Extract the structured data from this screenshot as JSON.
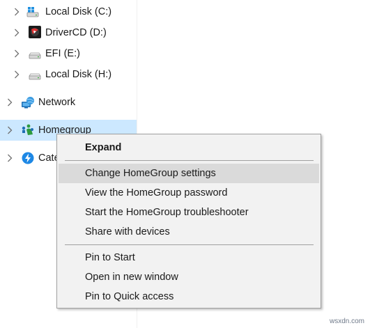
{
  "tree": {
    "items": [
      {
        "label": "Local Disk (C:)",
        "icon": "windows-drive-icon"
      },
      {
        "label": "DriverCD (D:)",
        "icon": "cd-drive-icon"
      },
      {
        "label": "EFI (E:)",
        "icon": "drive-icon"
      },
      {
        "label": "Local Disk (H:)",
        "icon": "drive-icon"
      },
      {
        "label": "Network",
        "icon": "network-icon"
      },
      {
        "label": "Homegroup",
        "icon": "homegroup-icon",
        "selected": true
      },
      {
        "label": "Cate",
        "icon": "thunderbolt-icon"
      }
    ]
  },
  "context_menu": {
    "items": [
      {
        "label": "Expand",
        "bold": true
      },
      {
        "label": "Change HomeGroup settings",
        "highlighted": true
      },
      {
        "label": "View the HomeGroup password"
      },
      {
        "label": "Start the HomeGroup troubleshooter"
      },
      {
        "label": "Share with devices"
      },
      {
        "label": "Pin to Start"
      },
      {
        "label": "Open in new window"
      },
      {
        "label": "Pin to Quick access"
      }
    ]
  },
  "watermark": "wsxdn.com",
  "colors": {
    "selection": "#cce8ff",
    "menu_background": "#f2f2f2",
    "menu_highlight": "#dadada"
  }
}
